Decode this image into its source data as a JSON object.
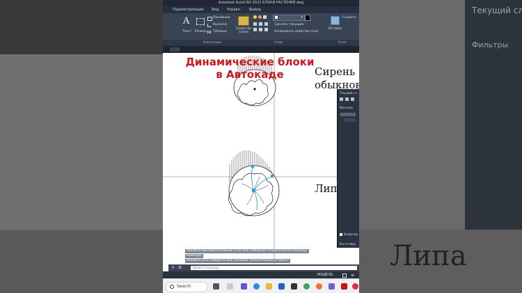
{
  "app": {
    "window_title": "Autodesk AutoCAD 2022   БЛОКИ РАСТЕНИЙ.dwg",
    "menu": [
      "Параметризация",
      "Вид",
      "Управл.",
      "Вывод"
    ]
  },
  "ribbon": {
    "text_label": "Текст",
    "dim_label": "Размер",
    "linear_label": "Линейный",
    "leader_label": "Выноска",
    "table_label": "Таблица",
    "layer_props_label": "Свойства слоев",
    "layer_match_label": "Сделать текущим",
    "layer_copy_label": "Копировать свойства слоя",
    "insert_label": "Вставка",
    "create_label": "Создать",
    "annotation_panel": "Аннотации",
    "layers_panel": "Слои",
    "block_panel": "Блок"
  },
  "canvas": {
    "overlay_title": "Динамические блоки в Автокаде",
    "label_top": "Сирень обыкнов",
    "label_bottom": "Липа"
  },
  "layer_panel": {
    "header": "Текущий сл",
    "filters": "Фильтры",
    "invert": "Инвертир",
    "all_used": "Все отобра"
  },
  "command": {
    "history": [
      "Укажите противоположный угол или [Заборная точка/Отменить/Выход]:",
      "Команда:",
      "Укажите угол поворота или [Базовая точка/Отменить/Через]:"
    ],
    "placeholder": "Введите команду"
  },
  "status": {
    "model": "МОДЕЛЬ"
  },
  "taskbar": {
    "search_label": "Search"
  },
  "background": {
    "right_panel_header": "Текущий сло",
    "right_panel_filters": "Фильтры",
    "bottom_right_label": "Липа"
  },
  "colors": {
    "title_red": "#d2141c",
    "grip_blue": "#2ea0e0"
  }
}
